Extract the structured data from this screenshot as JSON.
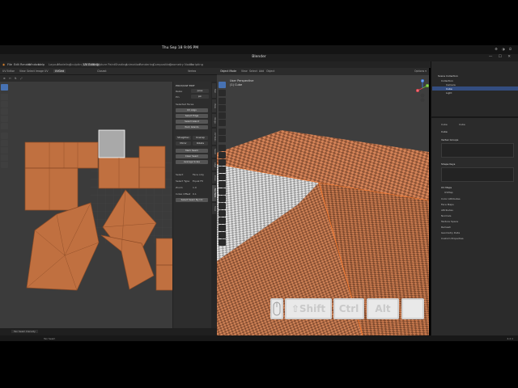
{
  "os_bar": {
    "clock": "Thu Sep 18 9:06 PM",
    "tray": "⚙ ◑ ⏻"
  },
  "window": {
    "title": "Blender",
    "controls": "— ☐ ✕"
  },
  "menu": {
    "items": [
      "File",
      "Edit",
      "Render",
      "Window",
      "Help"
    ],
    "workspaces": [
      "Layout",
      "Modeling",
      "Sculpting",
      "UV Editing",
      "Texture Paint",
      "Shading",
      "Animation",
      "Rendering",
      "Compositing",
      "Geometry Nodes",
      "Scripting"
    ],
    "active_workspace": "UV Editing",
    "scene_label": "Scene",
    "view_layer_label": "ViewLayer"
  },
  "uv_header": {
    "mode": "UV Editor",
    "menus": [
      "View",
      "Select",
      "Image",
      "UV"
    ],
    "image_name": "UVGrid",
    "snap": "Closest",
    "sync": "Vertex"
  },
  "uv_header2": {
    "items": [
      "⊕",
      "↔",
      "⇅",
      "⤢"
    ]
  },
  "npanel": {
    "title": "POLYQUILT EDIT",
    "sections": [
      {
        "label": "Relax",
        "value": "pose"
      },
      {
        "label": "Pin",
        "value": "pin"
      }
    ],
    "rows": [
      "Selected Faces",
      "UV Align",
      "Select Edge",
      "Select Island",
      "Pack Islands",
      "Straighten",
      "Unwrap",
      "Mirror",
      "Rotate"
    ],
    "buttons": [
      "Mark Seam",
      "Clear Seam",
      "Average Scale"
    ],
    "fields": [
      {
        "label": "Select",
        "value": "Face only"
      },
      {
        "label": "Select Type",
        "value": "Equal Fit"
      },
      {
        "label": "Zoom",
        "value": "1.0"
      },
      {
        "label": "Index Offset",
        "value": "0.1"
      }
    ],
    "action": "Select Seam By UV"
  },
  "uv_tabs": [
    "Tool",
    "View",
    "Image",
    "UV Tools",
    "Seam",
    "Align",
    "Draw",
    "Tex Tools",
    "Texel"
  ],
  "uv_status": "Tex Seam Density",
  "viewport": {
    "title": "User Perspective",
    "subtitle": "(1) Cube",
    "header_menus": [
      "Object Mode",
      "View",
      "Select",
      "Add",
      "Object"
    ],
    "header_right": "Options ▾",
    "gizmo_axes": [
      "Z",
      "Y",
      "X"
    ]
  },
  "outliner": {
    "title": "Scene Collection",
    "items": [
      {
        "name": "Collection",
        "depth": 0
      },
      {
        "name": "Camera",
        "depth": 1
      },
      {
        "name": "Cube",
        "depth": 1
      },
      {
        "name": "Light",
        "depth": 1
      }
    ],
    "selected": "Cube"
  },
  "properties": {
    "top": [
      "Cube",
      "Cube"
    ],
    "material": "Cube",
    "sections": [
      "Vertex Groups",
      "Shape Keys",
      "UV Maps",
      "Color Attributes",
      "Face Maps",
      "Attributes",
      "Normals",
      "Texture Space",
      "Remesh",
      "Geometry Data",
      "Custom Properties"
    ],
    "uvmap_item": "UVMap"
  },
  "status_bar": {
    "left": "Tex Seam",
    "right": "4.2.1"
  },
  "key_overlay": {
    "shift": "⇧Shift",
    "ctrl": "Ctrl",
    "alt": "Alt",
    "extra": ""
  },
  "colors": {
    "uv_island": "#c07040",
    "uv_selected": "#a9a9a9",
    "accent": "#4772b3",
    "checker_a": "#c97a4e",
    "checker_b": "#8e5436"
  }
}
